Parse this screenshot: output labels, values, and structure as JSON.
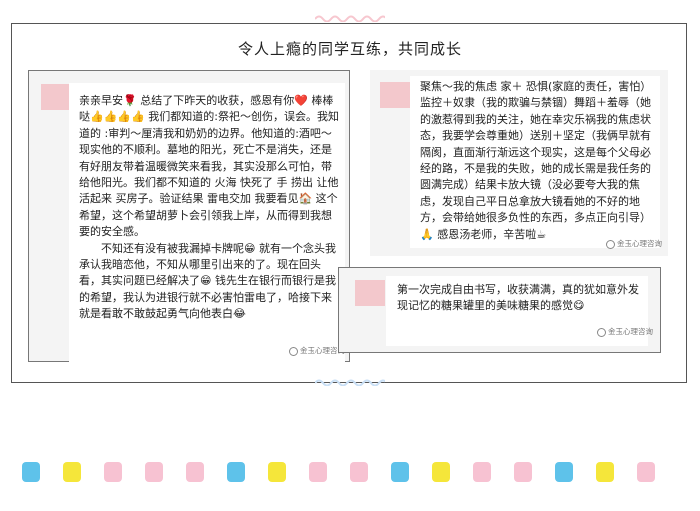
{
  "title": "令人上瘾的同学互练，共同成长",
  "cards": [
    {
      "message": "亲亲早安🌹 总结了下昨天的收获，感恩有你❤️ 棒棒哒👍👍👍👍 我们都知道的:祭祀～创伤，误会。我知道的 :审判～厘清我和奶奶的边界。他知道的:酒吧～现实他的不顺利。墓地的阳光，死亡不是消失，还是有好朋友带着温暖微笑来看我，其实没那么可怕，带给他阳光。我们都不知道的 火海 快死了 手 捞出 让他活起来 买房子。验证结果 雷电交加 我要看见🏠 这个希望，这个希望胡萝卜会引领我上岸，从而得到我想要的安全感。",
      "message2": "不知还有没有被我漏掉卡牌呢😁 就有一个念头我承认我暗恋他，不知从哪里引出来的了。现在回头看，其实问题已经解决了😁 钱先生在银行而银行是我的希望，我认为进银行就不必害怕雷电了，哈接下来就是看敢不敢鼓起勇气向他表白😂",
      "watermark": "金玉心理咨询"
    },
    {
      "message": "聚焦～我的焦虑 家＋ 恐惧(家庭的责任，害怕）监控＋奴隶（我的欺骗与禁锢）舞蹈＋羞辱（她的激惹得到我的关注，她在幸灾乐祸我的焦虑状态，我要学会尊重她）送别＋坚定（我俩早就有隔阂，直面渐行渐远这个现实，这是每个父母必经的路，不是我的失败，她的成长需是我任务的圆满完成）结果卡放大镜（没必要夸大我的焦虑，发现自己平日总拿放大镜看她的不好的地方，会带给她很多负性的东西，多点正向引导）🙏 感恩汤老师，辛苦啦☕",
      "watermark": "金玉心理咨询"
    },
    {
      "message": "第一次完成自由书写，收获满满，真的犹如意外发现记忆的糖果罐里的美味糖果的感觉😋",
      "watermark": "金玉心理咨询"
    }
  ],
  "colors": {
    "avatar": "#f3c8cc",
    "card_bg": "#f4f4f4",
    "wave": "#f7c7cf",
    "tiles": [
      "#5ec2ea",
      "#f5e63a",
      "#f7c2d2"
    ]
  }
}
